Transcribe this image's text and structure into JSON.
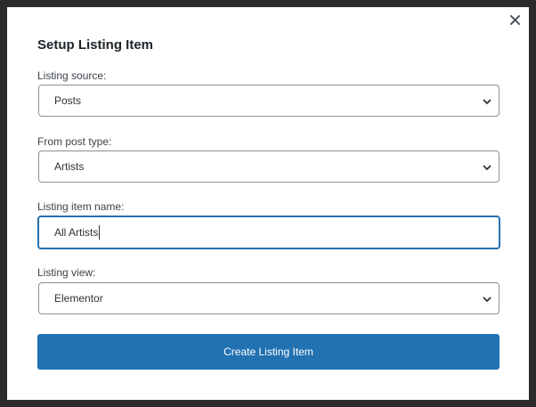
{
  "dialog": {
    "title": "Setup Listing Item",
    "close_icon": "close-icon"
  },
  "fields": {
    "listing_source": {
      "label": "Listing source:",
      "value": "Posts",
      "icon": "chevron-down-icon"
    },
    "post_type": {
      "label": "From post type:",
      "value": "Artists",
      "icon": "chevron-down-icon"
    },
    "item_name": {
      "label": "Listing item name:",
      "value": "All Artists"
    },
    "listing_view": {
      "label": "Listing view:",
      "value": "Elementor",
      "icon": "chevron-down-icon"
    }
  },
  "actions": {
    "create_label": "Create Listing Item"
  },
  "colors": {
    "accent": "#2271b1",
    "backdrop": "#2b2b2b",
    "border": "#8c8f94"
  }
}
